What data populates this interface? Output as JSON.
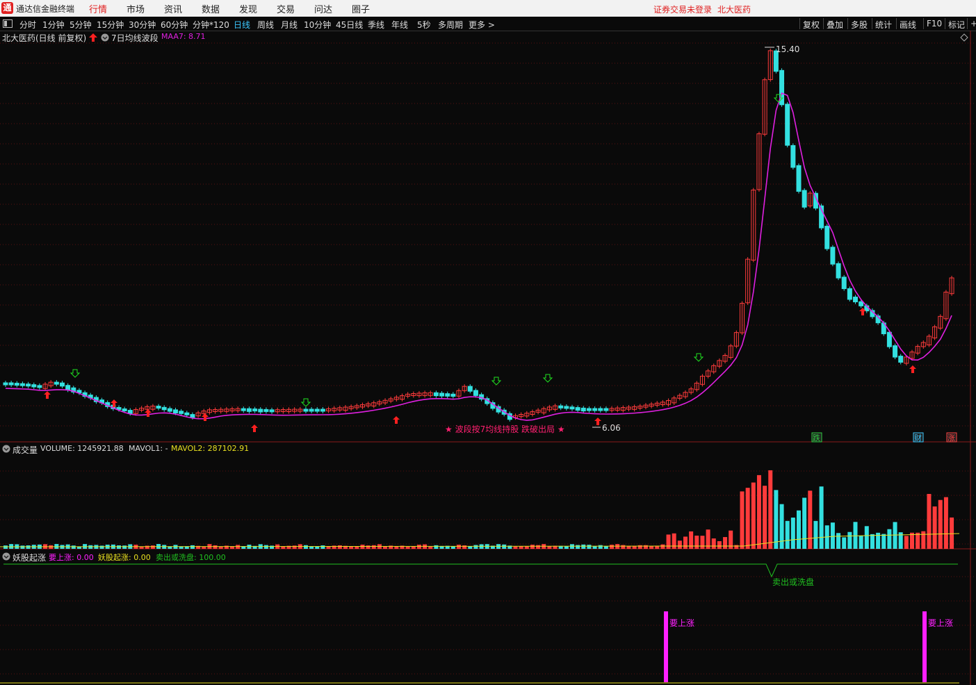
{
  "app": {
    "title": "通达信金融终端",
    "logo_icon": "通",
    "login_status": "证券交易未登录",
    "stock_name": "北大医药"
  },
  "menu": {
    "items": [
      "行情",
      "市场",
      "资讯",
      "数据",
      "发现",
      "交易",
      "问达",
      "圈子"
    ],
    "active": "行情"
  },
  "periods": {
    "items": [
      "分时",
      "1分钟",
      "5分钟",
      "15分钟",
      "30分钟",
      "60分钟",
      "分钟*120",
      "日线",
      "周线",
      "月线",
      "10分钟",
      "45日线",
      "季线",
      "年线",
      "5秒",
      "多周期",
      "更多 >"
    ],
    "active": "日线"
  },
  "right_tools": [
    "复权",
    "叠加",
    "多股",
    "统计",
    "画线",
    "F10",
    "标记",
    "+"
  ],
  "main": {
    "stock_label": "北大医药(日线 前复权)",
    "indicator_name": "7日均线波段",
    "ma_label": "MAA7: 8.71",
    "high_label": "15.40",
    "low_label": "6.06",
    "slogan": "★ 波段按7均线持股 跌破出局 ★",
    "badges": [
      {
        "text": "跌",
        "color": "#2ecc40"
      },
      {
        "text": "财",
        "color": "#3cc8ff"
      },
      {
        "text": "涨",
        "color": "#ff4040"
      }
    ]
  },
  "volume": {
    "name": "成交量",
    "volume_label": "VOLUME: 1245921.88",
    "mavol1_label": "MAVOL1: -",
    "mavol2_label": "MAVOL2: 287102.91"
  },
  "indicator": {
    "name": "妖股起涨",
    "up_label": "要上涨: 0.00",
    "yao_label": "妖股起涨: 0.00",
    "sell_label": "卖出或洗盘: 100.00",
    "sell_mark": "卖出或洗盘",
    "up_mark": "要上涨"
  },
  "colors": {
    "up": "#ff3b3b",
    "down": "#33e0e0",
    "ma": "#e020e0",
    "volume_ma": "#e8e020",
    "signal": "#20c020",
    "bar": "#ff20ff",
    "buy_arrow": "#ff2020",
    "sell_arrow": "#20e020"
  }
}
